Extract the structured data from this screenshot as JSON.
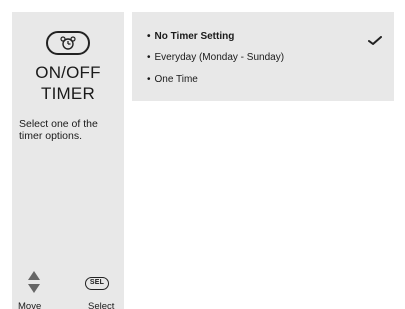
{
  "sidebar": {
    "icon": "timer-clock-icon",
    "title": "ON/OFF TIMER",
    "help": "Select one of the timer options.",
    "nav": {
      "move_icon": "up-down-arrows-icon",
      "move_label": "Move",
      "select_icon": "sel-button-icon",
      "select_badge": "SEL",
      "select_label": "Select"
    }
  },
  "options": {
    "items": [
      {
        "label": "No Timer Setting",
        "selected": true
      },
      {
        "label": "Everyday (Monday - Sunday)",
        "selected": false
      },
      {
        "label": "One Time",
        "selected": false
      }
    ],
    "check_icon": "checkmark-icon"
  }
}
